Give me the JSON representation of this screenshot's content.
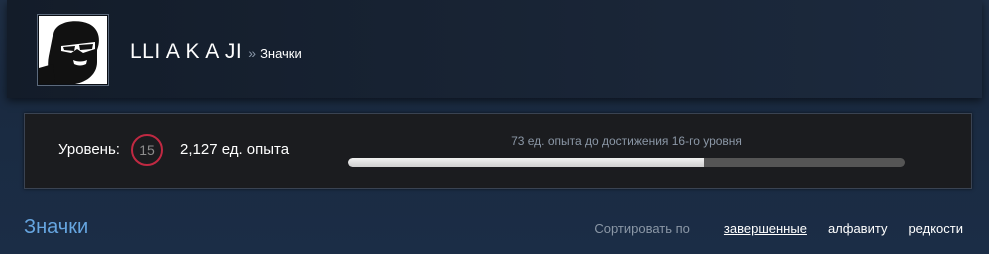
{
  "profile": {
    "persona_name": "LLI A K A JI",
    "breadcrumb_separator": "»",
    "page_name": "Значки",
    "avatar_icon": "masked-face-avatar-icon"
  },
  "level": {
    "label": "Уровень:",
    "value": "15",
    "xp_text": "2,127 ед. опыта",
    "progress_caption": "73 ед. опыта до достижения 16-го уровня",
    "progress_fraction": 0.64,
    "badge_ring_color": "#c02942"
  },
  "badges_section": {
    "title": "Значки",
    "sort_label": "Сортировать по",
    "sort_options": [
      "завершенные",
      "алфавиту",
      "редкости"
    ],
    "active_sort": "завершенные",
    "accent_color": "#66a5e0"
  }
}
